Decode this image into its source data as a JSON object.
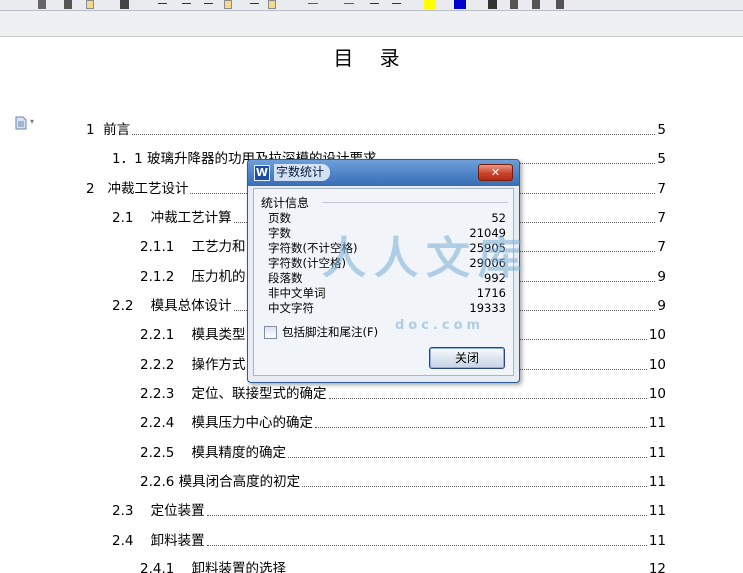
{
  "toc": {
    "title": "目 录",
    "rows": [
      {
        "num": "1  ",
        "text": "前言",
        "page": "5"
      },
      {
        "num": "1．1 ",
        "text": "玻璃升降器的功用及拉深模的设计要求",
        "page": "5"
      },
      {
        "num": "2   ",
        "text": "冲裁工艺设计",
        "page": "7"
      },
      {
        "num": "2.1    ",
        "text": "冲裁工艺计算",
        "page": "7"
      },
      {
        "num": "2.1.1    ",
        "text": "工艺力和",
        "page": "7"
      },
      {
        "num": "2.1.2    ",
        "text": "压力机的",
        "page": "9"
      },
      {
        "num": "2.2    ",
        "text": "模具总体设计",
        "page": "9"
      },
      {
        "num": "2.2.1    ",
        "text": "模具类型",
        "page": "10"
      },
      {
        "num": "2.2.2    ",
        "text": "操作方式",
        "page": "10"
      },
      {
        "num": "2.2.3    ",
        "text": "定位、联接型式的确定",
        "page": "10"
      },
      {
        "num": "2.2.4    ",
        "text": "模具压力中心的确定",
        "page": "11"
      },
      {
        "num": "2.2.5    ",
        "text": "模具精度的确定",
        "page": "11"
      },
      {
        "num": "2.2.6 ",
        "text": "模具闭合高度的初定",
        "page": "11"
      },
      {
        "num": "2.3    ",
        "text": "定位装置",
        "page": "11"
      },
      {
        "num": "2.4    ",
        "text": "卸料装置",
        "page": "11"
      },
      {
        "num": "2.4.1    ",
        "text": "卸料装置的选择",
        "page": "12"
      }
    ]
  },
  "dialog": {
    "app_icon": "W",
    "title": "字数统计",
    "close_label": "✕",
    "group_label": "统计信息",
    "stats": [
      {
        "label": "页数",
        "value": "52"
      },
      {
        "label": "字数",
        "value": "21049"
      },
      {
        "label": "字符数(不计空格)",
        "value": "25905"
      },
      {
        "label": "字符数(计空格)",
        "value": "29006"
      },
      {
        "label": "段落数",
        "value": "992"
      },
      {
        "label": "非中文单词",
        "value": "1716"
      },
      {
        "label": "中文字符",
        "value": "19333"
      }
    ],
    "checkbox_label": "包括脚注和尾注(F)",
    "checkbox_checked": false,
    "ok_label": "关闭"
  },
  "watermark": {
    "main": "人人文库",
    "sub": "doc.com"
  },
  "colors": {
    "titlebar": "#4c82c7",
    "close": "#c9432a",
    "dialog_bg": "#e8edf5",
    "highlight_yellow": "#ffff00",
    "highlight_blue": "#0000cc"
  }
}
